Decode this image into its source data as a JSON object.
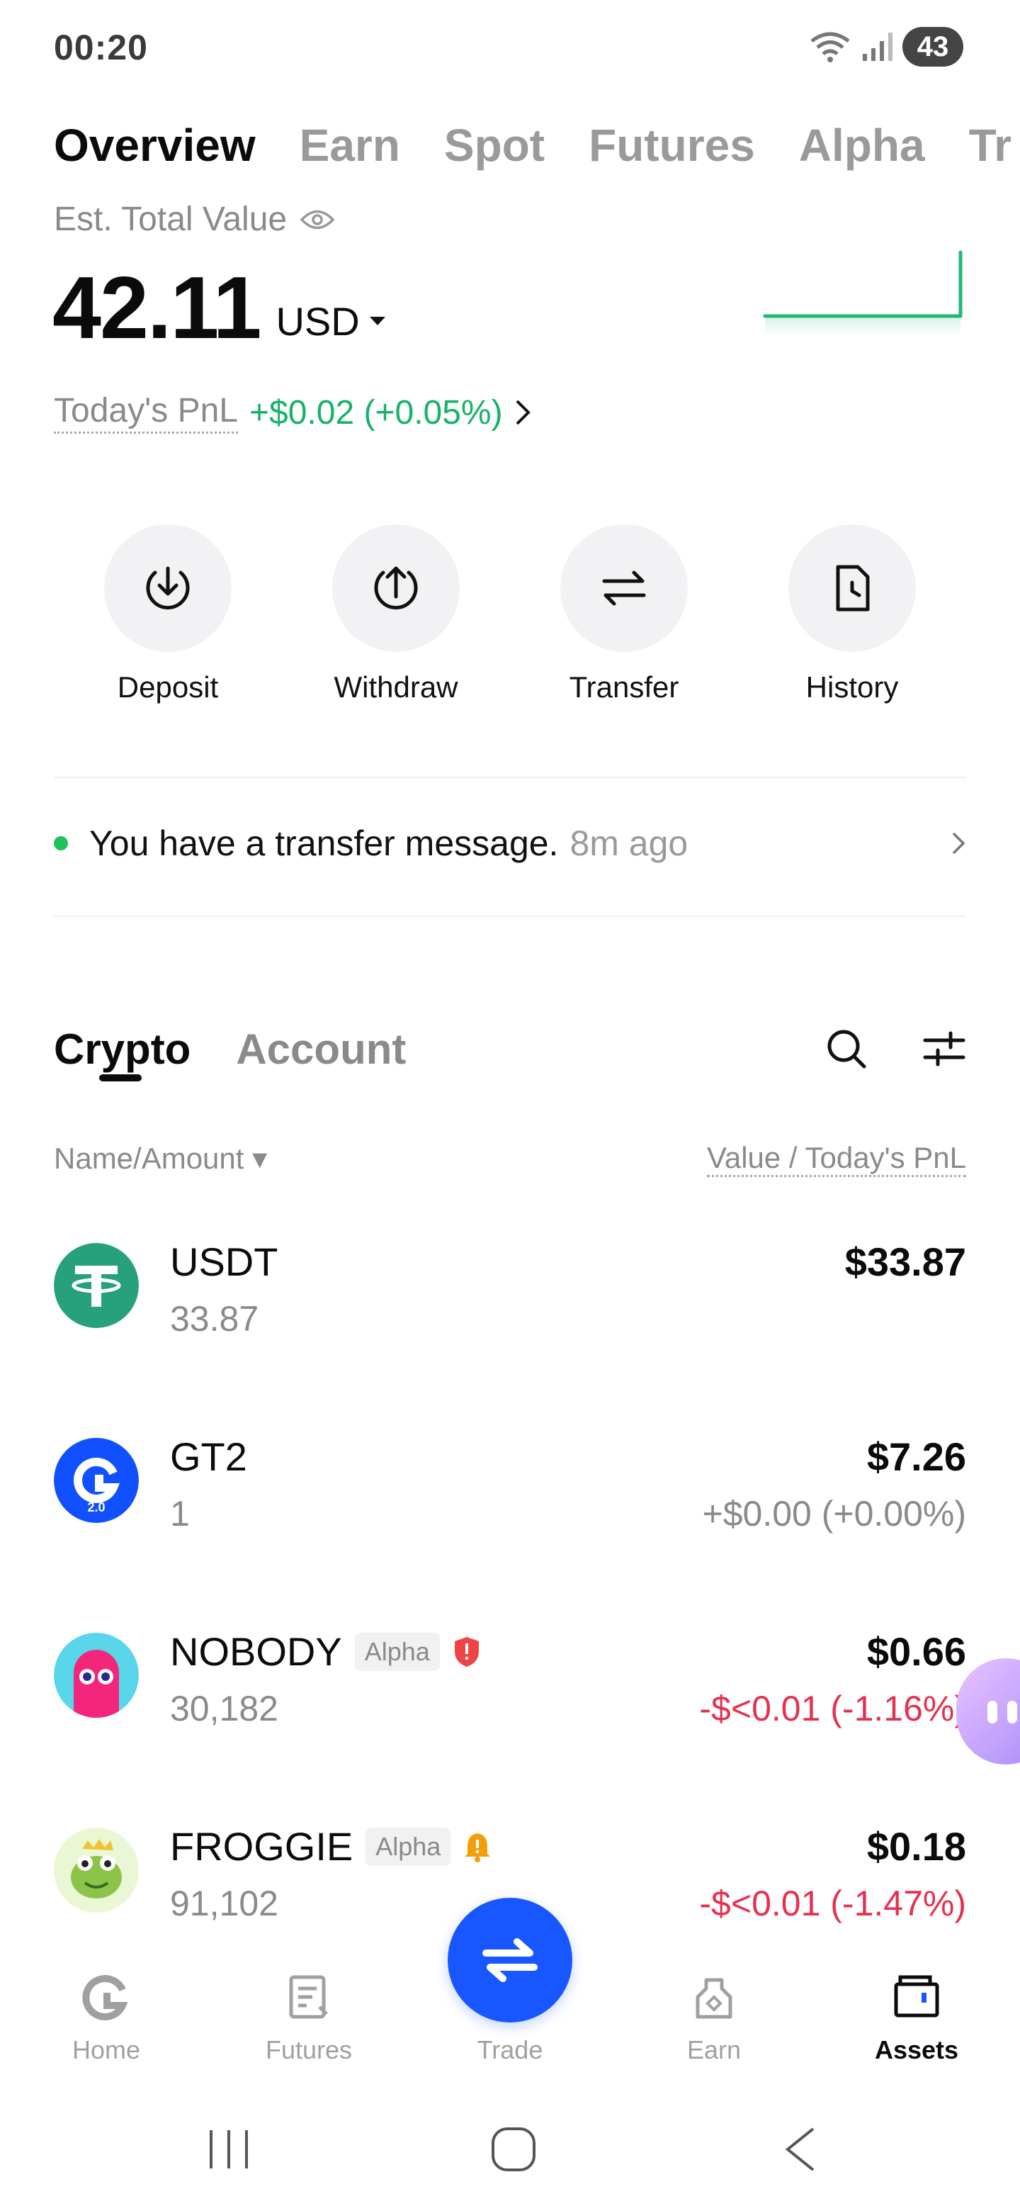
{
  "status_bar": {
    "time": "00:20",
    "battery": "43"
  },
  "top_tabs": [
    "Overview",
    "Earn",
    "Spot",
    "Futures",
    "Alpha",
    "Tr"
  ],
  "overview": {
    "est_label": "Est. Total Value",
    "balance": "42.11",
    "currency": "USD",
    "pnl_label": "Today's PnL",
    "pnl_value": "+$0.02 (+0.05%)"
  },
  "actions": [
    {
      "label": "Deposit",
      "icon": "deposit-icon"
    },
    {
      "label": "Withdraw",
      "icon": "withdraw-icon"
    },
    {
      "label": "Transfer",
      "icon": "transfer-icon"
    },
    {
      "label": "History",
      "icon": "history-icon"
    }
  ],
  "notice": {
    "text": "You have a transfer message.",
    "time": "8m ago"
  },
  "asset_tabs": {
    "crypto": "Crypto",
    "account": "Account"
  },
  "columns": {
    "left": "Name/Amount",
    "right": "Value / Today's PnL"
  },
  "assets": [
    {
      "name": "USDT",
      "tag": "",
      "amount": "33.87",
      "value": "$33.87",
      "pnl": "",
      "pnl_status": "neutral"
    },
    {
      "name": "GT2",
      "tag": "",
      "amount": "1",
      "value": "$7.26",
      "pnl": "+$0.00 (+0.00%)",
      "pnl_status": "neutral"
    },
    {
      "name": "NOBODY",
      "tag": "Alpha",
      "amount": "30,182",
      "value": "$0.66",
      "pnl": "-$<0.01 (-1.16%)",
      "pnl_status": "negative"
    },
    {
      "name": "FROGGIE",
      "tag": "Alpha",
      "amount": "91,102",
      "value": "$0.18",
      "pnl": "-$<0.01 (-1.47%)",
      "pnl_status": "negative"
    }
  ],
  "bottom_nav": {
    "home": "Home",
    "futures": "Futures",
    "trade": "Trade",
    "earn": "Earn",
    "assets": "Assets"
  },
  "colors": {
    "accent": "#1857ff",
    "positive": "#17b26a",
    "negative": "#e5314f"
  }
}
